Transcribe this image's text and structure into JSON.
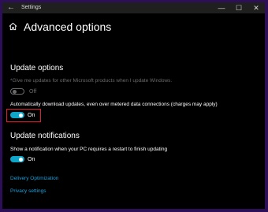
{
  "window": {
    "title": "Settings",
    "controls": {
      "minimize": "—",
      "maximize": "☐",
      "close": "✕"
    }
  },
  "page": {
    "title": "Advanced options"
  },
  "update_options": {
    "heading": "Update options",
    "other_products": {
      "label": "*Give me updates for other Microsoft products when I update Windows.",
      "state": "Off",
      "enabled": false
    },
    "metered": {
      "label": "Automatically download updates, even over metered data connections (charges may apply)",
      "state": "On"
    }
  },
  "update_notifications": {
    "heading": "Update notifications",
    "restart_notify": {
      "label": "Show a notification when your PC requires a restart to finish updating",
      "state": "On"
    }
  },
  "links": {
    "delivery_optimization": "Delivery Optimization",
    "privacy_settings": "Privacy settings"
  },
  "colors": {
    "accent": "#0ea5c9",
    "link": "#1e9ed9",
    "highlight": "#e11d2b",
    "background": "#000000",
    "frame": "#2d0f57"
  },
  "icons": {
    "back": "back-arrow-icon",
    "home": "home-icon"
  }
}
